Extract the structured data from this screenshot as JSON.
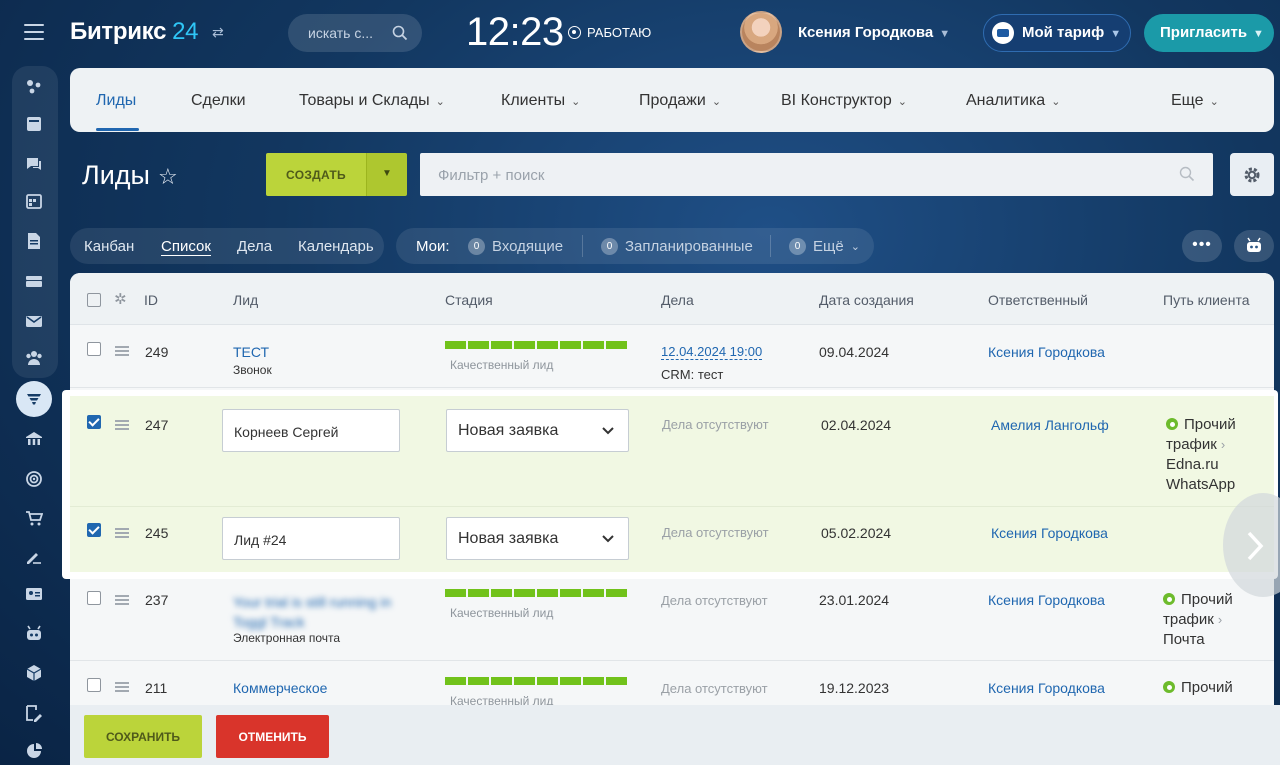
{
  "header": {
    "brand_name": "Битрикс",
    "brand_num": "24",
    "search_placeholder": "искать с...",
    "time": "12:23",
    "work_status": "РАБОТАЮ",
    "user_name": "Ксения Городкова",
    "tariff_label": "Мой тариф",
    "invite_label": "Пригласить"
  },
  "sidebar": {
    "icons": [
      "activity-icon",
      "feed-icon",
      "chat-icon",
      "calendar-icon",
      "document-icon",
      "drive-icon",
      "mail-icon",
      "group-icon",
      "crm-icon",
      "sites-icon",
      "target-icon",
      "cart-icon",
      "sign-icon",
      "contact-card-icon",
      "robot-icon",
      "box-icon",
      "tasks-edit-icon",
      "analytics-icon"
    ]
  },
  "nav": {
    "items": [
      {
        "label": "Лиды"
      },
      {
        "label": "Сделки"
      },
      {
        "label": "Товары и Склады"
      },
      {
        "label": "Клиенты"
      },
      {
        "label": "Продажи"
      },
      {
        "label": "BI Конструктор"
      },
      {
        "label": "Аналитика"
      },
      {
        "label": "Еще"
      }
    ]
  },
  "toolbar": {
    "title": "Лиды",
    "create_label": "СОЗДАТЬ",
    "filter_placeholder": "Фильтр + поиск"
  },
  "views": {
    "items": [
      "Канбан",
      "Список",
      "Дела",
      "Календарь"
    ],
    "active": "Список"
  },
  "counters": {
    "label": "Мои:",
    "items": [
      {
        "count": "0",
        "label": "Входящие"
      },
      {
        "count": "0",
        "label": "Запланированные"
      },
      {
        "count": "0",
        "label": "Ещё"
      }
    ]
  },
  "grid": {
    "columns": [
      "ID",
      "Лид",
      "Стадия",
      "Дела",
      "Дата создания",
      "Ответственный",
      "Путь клиента"
    ],
    "rows": [
      {
        "id": "249",
        "name": "ТЕСТ",
        "source": "Звонок",
        "stage": "Качественный лид",
        "stage_progress": 1.0,
        "activity_date": "12.04.2024 19:00",
        "activity_text": "CRM: тест",
        "created": "09.04.2024",
        "responsible": "Ксения Городкова",
        "selected": false
      },
      {
        "id": "247",
        "name": "Корнеев Сергей",
        "stage": "Новая заявка",
        "activity": "Дела отсутствуют",
        "created": "02.04.2024",
        "responsible": "Амелия Лангольф",
        "path": [
          "Прочий",
          "трафик",
          "Edna.ru",
          "WhatsApp"
        ],
        "selected": true
      },
      {
        "id": "245",
        "name": "Лид #24",
        "stage": "Новая заявка",
        "activity": "Дела отсутствуют",
        "created": "05.02.2024",
        "responsible": "Ксения Городкова",
        "selected": true
      },
      {
        "id": "237",
        "name": "Your trial is still running in Toggl Track",
        "source": "Электронная почта",
        "stage": "Качественный лид",
        "stage_progress": 1.0,
        "activity": "Дела отсутствуют",
        "created": "23.01.2024",
        "responsible": "Ксения Городкова",
        "path": [
          "Прочий",
          "трафик",
          "Почта"
        ],
        "selected": false
      },
      {
        "id": "211",
        "name": "Коммерческое",
        "stage": "Качественный лид",
        "stage_progress": 1.0,
        "activity": "Дела отсутствуют",
        "created": "19.12.2023",
        "responsible": "Ксения Городкова",
        "path": [
          "Прочий"
        ],
        "selected": false
      }
    ]
  },
  "footer": {
    "save_label": "СОХРАНИТЬ",
    "cancel_label": "ОТМЕНИТЬ"
  },
  "colors": {
    "accent_blue": "#2067b0",
    "create_green": "#bbd43a",
    "stage_green": "#71c21b",
    "cancel_red": "#d9342b",
    "highlight_row": "#f1f8e3"
  }
}
